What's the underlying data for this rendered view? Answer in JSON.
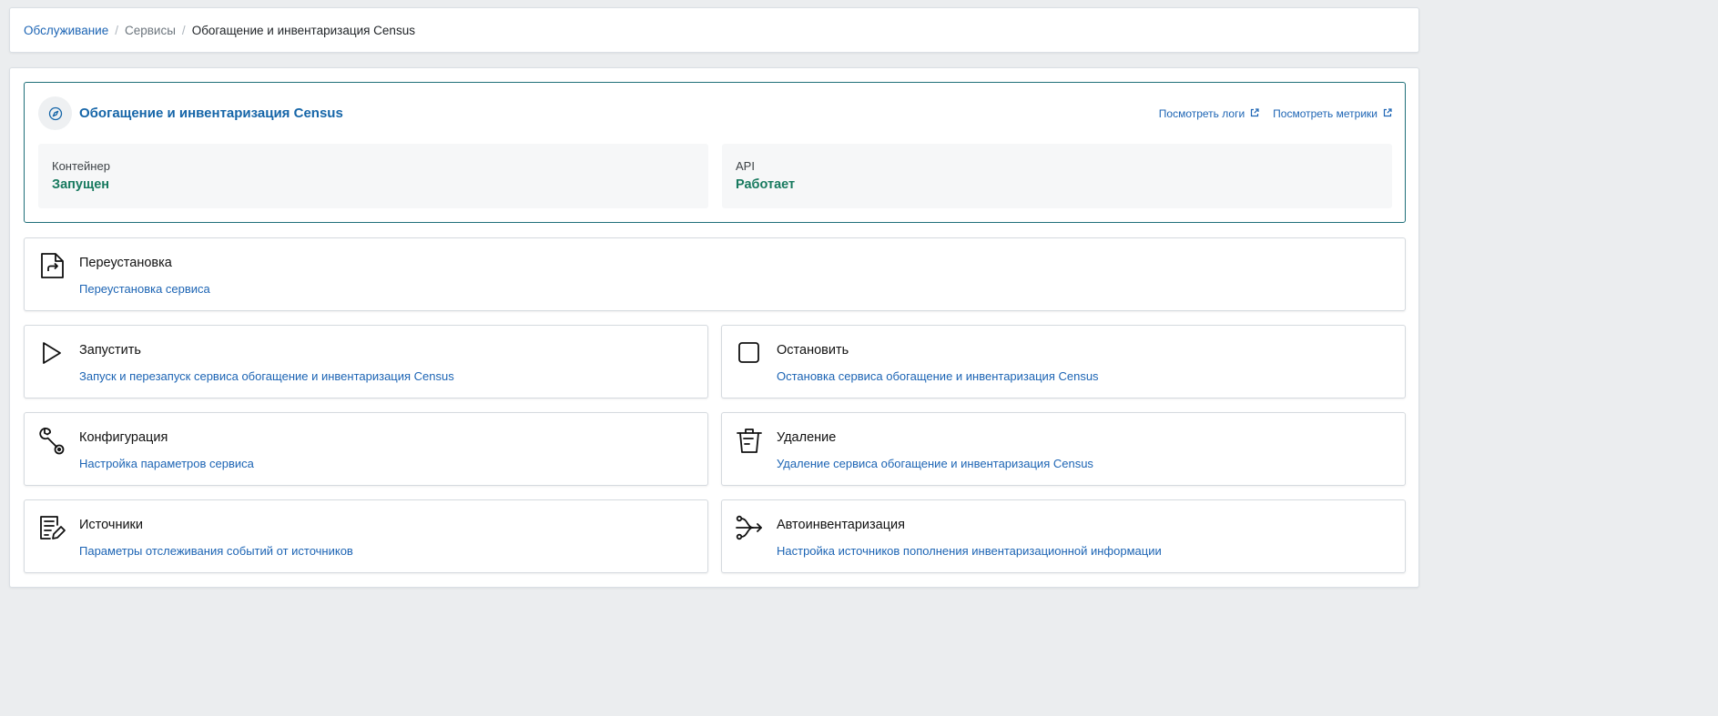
{
  "breadcrumb": {
    "items": [
      {
        "label": "Обслуживание"
      },
      {
        "label": "Сервисы"
      },
      {
        "label": "Обогащение и инвентаризация Census"
      }
    ],
    "separator": "/"
  },
  "service": {
    "title": "Обогащение и инвентаризация Census",
    "icon": "compass-icon",
    "links": {
      "logs": "Посмотреть логи",
      "metrics": "Посмотреть метрики"
    },
    "container": {
      "label": "Контейнер",
      "value": "Запущен"
    },
    "api": {
      "label": "API",
      "value": "Работает"
    }
  },
  "actions": {
    "reinstall": {
      "title": "Переустановка",
      "description": "Переустановка сервиса",
      "icon": "file-reinstall-icon"
    },
    "start": {
      "title": "Запустить",
      "description": "Запуск и перезапуск сервиса обогащение и инвентаризация Census",
      "icon": "play-icon"
    },
    "stop": {
      "title": "Остановить",
      "description": "Остановка сервиса обогащение и инвентаризация Census",
      "icon": "stop-icon"
    },
    "config": {
      "title": "Конфигурация",
      "description": "Настройка параметров сервиса",
      "icon": "wrench-icon"
    },
    "delete": {
      "title": "Удаление",
      "description": "Удаление сервиса обогащение и инвентаризация Census",
      "icon": "trash-icon"
    },
    "sources": {
      "title": "Источники",
      "description": "Параметры отслеживания событий от источников",
      "icon": "list-edit-icon"
    },
    "autoinventory": {
      "title": "Автоинвентаризация",
      "description": "Настройка источников пополнения инвентаризационной информации",
      "icon": "merge-arrows-icon"
    }
  },
  "colors": {
    "link": "#1c64b4",
    "title_accent": "#1565a8",
    "status_ok": "#187a5f",
    "panel_border": "#1f6f79"
  }
}
